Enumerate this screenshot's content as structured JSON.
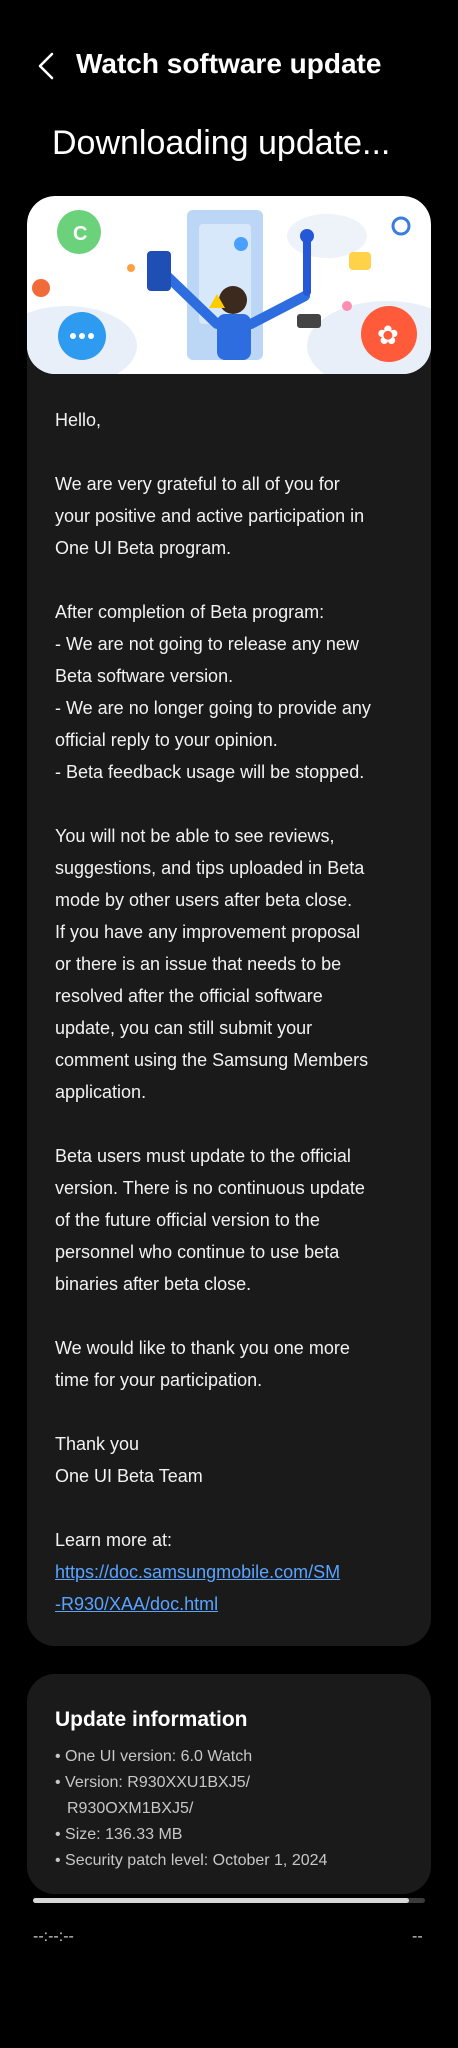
{
  "header": {
    "title": "Watch software update",
    "back_icon": "chevron-left-icon"
  },
  "status": {
    "heading": "Downloading update..."
  },
  "notice": {
    "greeting": "Hello,",
    "p1_lines": [
      "We are very grateful to all of you for",
      "your positive and active participation in",
      "One UI Beta program."
    ],
    "p2_lines": [
      "After completion of Beta program:",
      " - We are not going to release any new",
      "Beta software version.",
      " - We are no longer going to provide any",
      "official reply to your opinion.",
      " - Beta feedback usage will be stopped."
    ],
    "p3_lines": [
      "You will not be able to see reviews,",
      "suggestions, and tips uploaded in Beta",
      "mode by other users after beta close.",
      "If you have any improvement proposal",
      "or there is an issue that needs to be",
      "resolved after the official software",
      "update, you can still submit your",
      "comment using the Samsung Members",
      "application."
    ],
    "p4_lines": [
      "Beta users must update to the official",
      "version. There is no continuous update",
      "of the future official version to the",
      "personnel who continue to use beta",
      "binaries after beta close."
    ],
    "p5_lines": [
      "We would like to thank you one more",
      "time for your participation."
    ],
    "signoff_lines": [
      "Thank you",
      "One UI Beta Team"
    ],
    "learn_more": "Learn more at:",
    "link_lines": [
      "https://doc.samsungmobile.com/SM",
      "-R930/XAA/doc.html"
    ]
  },
  "update_info": {
    "title": "Update information",
    "rows": [
      "• One UI version: 6.0 Watch",
      "• Version: R930XXU1BXJ5/",
      "R930OXM1BXJ5/",
      "• Size: 136.33 MB",
      "• Security patch level: October 1, 2024"
    ]
  },
  "progress": {
    "fraction": 0.96,
    "time_left": "--:--:--",
    "time_right": "--"
  },
  "colors": {
    "background": "#000000",
    "card": "#1a1a1b",
    "link": "#5aa4ff"
  }
}
